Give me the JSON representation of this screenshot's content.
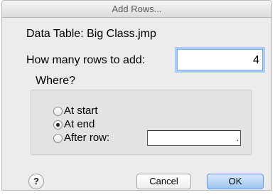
{
  "window": {
    "title": "Add Rows..."
  },
  "data_table": {
    "label": "Data Table: Big Class.jmp"
  },
  "rows_to_add": {
    "label": "How many rows to add:",
    "value": "4"
  },
  "where": {
    "label": "Where?",
    "options": [
      {
        "label": "At start",
        "checked": false
      },
      {
        "label": "At end",
        "checked": true
      },
      {
        "label": "After row:",
        "checked": false
      }
    ],
    "after_row_value": "."
  },
  "buttons": {
    "help": "?",
    "cancel": "Cancel",
    "ok": "OK"
  }
}
